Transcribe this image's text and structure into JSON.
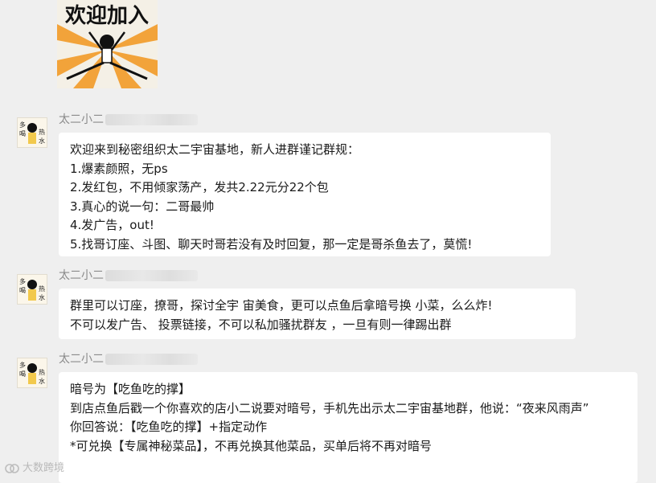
{
  "sticker": {
    "text": "欢迎加入"
  },
  "avatar": {
    "chars": [
      "多",
      "喝",
      "热",
      "水"
    ]
  },
  "messages": [
    {
      "sender": "太二小二",
      "lines": [
        "欢迎来到秘密组织太二宇宙基地，新人进群谨记群规：",
        "1.爆素颜照，无ps",
        "2.发红包，不用倾家荡产，发共2.22元分22个包",
        "3.真心的说一句：二哥最帅",
        "4.发广告，out!",
        "5.找哥订座、斗图、聊天时哥若没有及时回复，那一定是哥杀鱼去了，莫慌!"
      ]
    },
    {
      "sender": "太二小二",
      "lines": [
        "群里可以订座，撩哥，探讨全宇 宙美食，更可以点鱼后拿暗号换 小菜，么么炸!",
        "不可以发广告、 投票链接，不可以私加骚扰群友 ，一旦有则一律踢出群"
      ]
    },
    {
      "sender": "太二小二",
      "lines": [
        "暗号为【吃鱼吃的撑】",
        "到店点鱼后戳一个你喜欢的店小二说要对暗号，手机先出示太二宇宙基地群，他说：“夜来风雨声”",
        "你回答说：【吃鱼吃的撑】+指定动作",
        "*可兑换【专属神秘菜品】，不再兑换其他菜品，买单后将不再对暗号"
      ]
    }
  ],
  "watermark": {
    "text": "大数跨境"
  }
}
